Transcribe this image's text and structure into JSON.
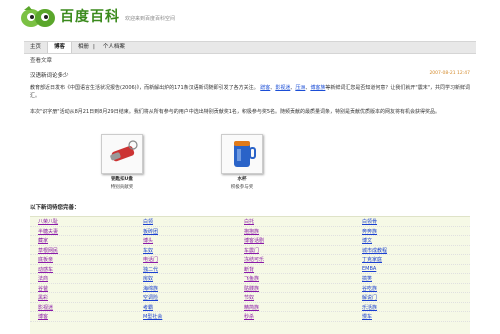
{
  "header": {
    "brand": "百度百科",
    "tagline": "欢迎来到百度百科空间",
    "links": [
      "",
      "",
      "",
      ""
    ]
  },
  "nav": {
    "tabs": [
      "主页",
      "博客",
      "相册",
      "|",
      "个人档案"
    ]
  },
  "section_label": "查看文章",
  "post": {
    "title": "汉语新词论多少",
    "date": "2007-08-21 12:47",
    "p1_a": "教育部近日发布《中国语言生活状况报告(2006)》，而新解出炉的171条汉语新词随即引发了各方关注。",
    "p1_links": [
      "蹭客",
      "影视迷",
      "压洲",
      "博客族"
    ],
    "p1_b": "等新鲜词汇您是否知道何意？让我们就开\"震末\"，共同学习新鲜词汇。",
    "p2": "本次\"识字册\"活动从8月21日到8月29日结束。我们将从所有参与的用户中选出特别贡献奖1名，积极参与奖5名。随频贡献的最质量词条，特别是贡献优质版本的网友将有机会获得奖品。"
  },
  "prizes": [
    {
      "name": "钥匙扣U盘",
      "desc": "特别贡献奖"
    },
    {
      "name": "水杯",
      "desc": "积极参与奖"
    }
  ],
  "topics_title": "以下新词待您完善：",
  "topics": [
    [
      "八荣八耻",
      "白领",
      "白托",
      "白领骨"
    ],
    [
      "半糖夫妻",
      "板砖团",
      "抱抱族",
      "奔奔族"
    ],
    [
      "藏家",
      "博头",
      "博客话剧",
      "博文"
    ],
    [
      "草根网民",
      "车奴",
      "车震门",
      "城市成教程"
    ],
    [
      "底板亲",
      "电话门",
      "冻结可乐",
      "丁克家庭"
    ],
    [
      "动感车",
      "独二代",
      "断背",
      "EMBA"
    ],
    [
      "法商",
      "房奴",
      "飞鱼族",
      "搞笑"
    ],
    [
      "谷爸",
      "海绵族",
      "骷髅族",
      "谷吃族"
    ],
    [
      "黑彩",
      "空调险",
      "节奴",
      "解说门"
    ],
    [
      "影视迷",
      "考霸",
      "精简族",
      "乐活族"
    ],
    [
      "博客",
      "M型社会",
      "秒杀",
      "慢车"
    ]
  ],
  "colors": {
    "brand_green": "#3a8a1c",
    "link_blue": "#1b40d0",
    "link_purple": "#8a1aa8",
    "date_orange": "#d38a2c",
    "topics_bg": "#f6f9e6",
    "nav_bg": "#e8e8e8"
  }
}
